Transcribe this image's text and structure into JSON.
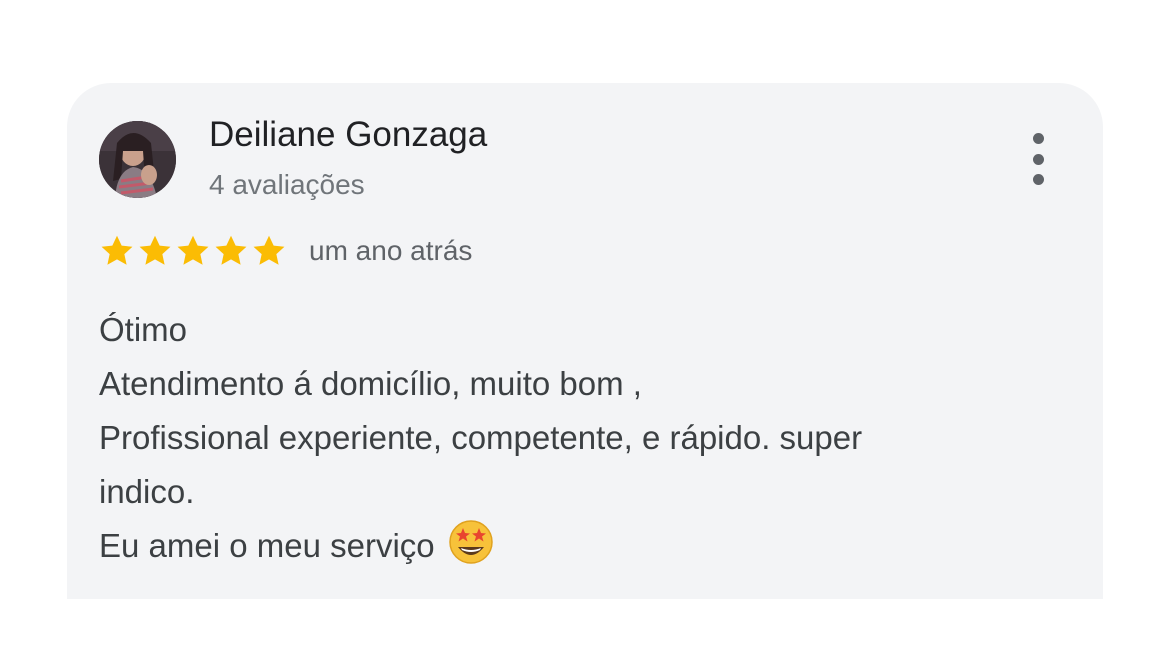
{
  "review": {
    "author_name": "Deiliane Gonzaga",
    "review_count": "4 avaliações",
    "rating": 5,
    "rating_max": 5,
    "time_ago": "um ano atrás",
    "text_lines": [
      "Ótimo",
      "Atendimento á domicílio, muito bom ,",
      "Profissional experiente, competente, e rápido. super",
      "indico.",
      "Eu amei o meu serviço"
    ],
    "emoji": "star-struck-emoji"
  },
  "colors": {
    "card_background": "#f3f4f6",
    "star": "#fbbc04",
    "name_text": "#202124",
    "secondary_text": "#70757a",
    "body_text": "#3c4043"
  },
  "icons": {
    "menu": "more-vertical-icon",
    "star": "star-icon",
    "avatar": "user-avatar"
  }
}
